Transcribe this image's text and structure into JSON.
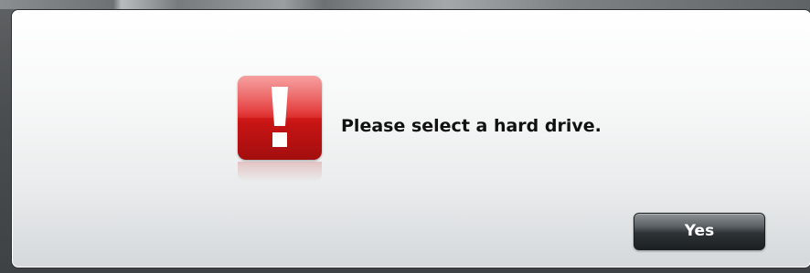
{
  "dialog": {
    "icon": "exclamation-alert-icon",
    "icon_color": "#e02222",
    "message": "Please select a hard drive.",
    "buttons": {
      "yes_label": "Yes"
    }
  }
}
